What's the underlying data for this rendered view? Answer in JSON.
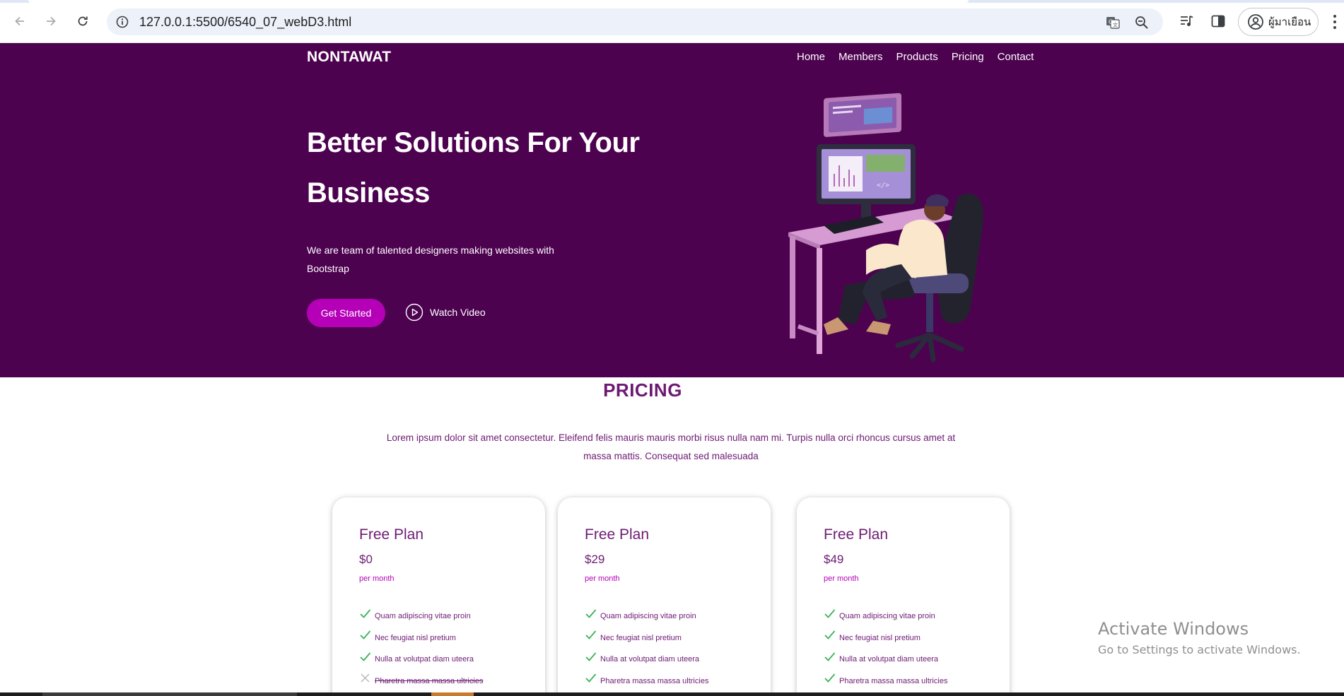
{
  "browser": {
    "url": "127.0.0.1:5500/6540_07_webD3.html",
    "profile_label": "ผู้มาเยือน",
    "icons": [
      "back-arrow-icon",
      "forward-arrow-icon",
      "reload-icon",
      "info-icon",
      "translate-icon",
      "zoom-icon",
      "media-control-icon",
      "side-panel-icon",
      "profile-icon",
      "more-menu-icon"
    ]
  },
  "navbar": {
    "brand": "NONTAWAT",
    "links": [
      "Home",
      "Members",
      "Products",
      "Pricing",
      "Contact"
    ]
  },
  "hero": {
    "title": "Better Solutions For Your Business",
    "subtitle": "We are team of talented designers making websites with Bootstrap",
    "primary_button": "Get Started",
    "video_button": "Watch Video",
    "background_color": "#4d0250",
    "accent_color": "#b600b8"
  },
  "pricing": {
    "title": "PRICING",
    "description": "Lorem ipsum dolor sit amet consectetur. Eleifend felis mauris mauris morbi risus nulla nam mi. Turpis nulla orci rhoncus cursus amet at massa mattis. Consequat sed malesuada",
    "text_color": "#6d1a73",
    "plans": [
      {
        "name": "Free Plan",
        "price": "$0",
        "period": "per month",
        "features": [
          {
            "text": "Quam adipiscing vitae proin",
            "included": true
          },
          {
            "text": "Nec feugiat nisl pretium",
            "included": true
          },
          {
            "text": "Nulla at volutpat diam uteera",
            "included": true
          },
          {
            "text": "Pharetra massa massa ultricies",
            "included": false
          }
        ]
      },
      {
        "name": "Free Plan",
        "price": "$29",
        "period": "per month",
        "features": [
          {
            "text": "Quam adipiscing vitae proin",
            "included": true
          },
          {
            "text": "Nec feugiat nisl pretium",
            "included": true
          },
          {
            "text": "Nulla at volutpat diam uteera",
            "included": true
          },
          {
            "text": "Pharetra massa massa ultricies",
            "included": true
          }
        ]
      },
      {
        "name": "Free Plan",
        "price": "$49",
        "period": "per month",
        "features": [
          {
            "text": "Quam adipiscing vitae proin",
            "included": true
          },
          {
            "text": "Nec feugiat nisl pretium",
            "included": true
          },
          {
            "text": "Nulla at volutpat diam uteera",
            "included": true
          },
          {
            "text": "Pharetra massa massa ultricies",
            "included": true
          }
        ]
      }
    ]
  },
  "watermark": {
    "line1": "Activate Windows",
    "line2": "Go to Settings to activate Windows."
  }
}
